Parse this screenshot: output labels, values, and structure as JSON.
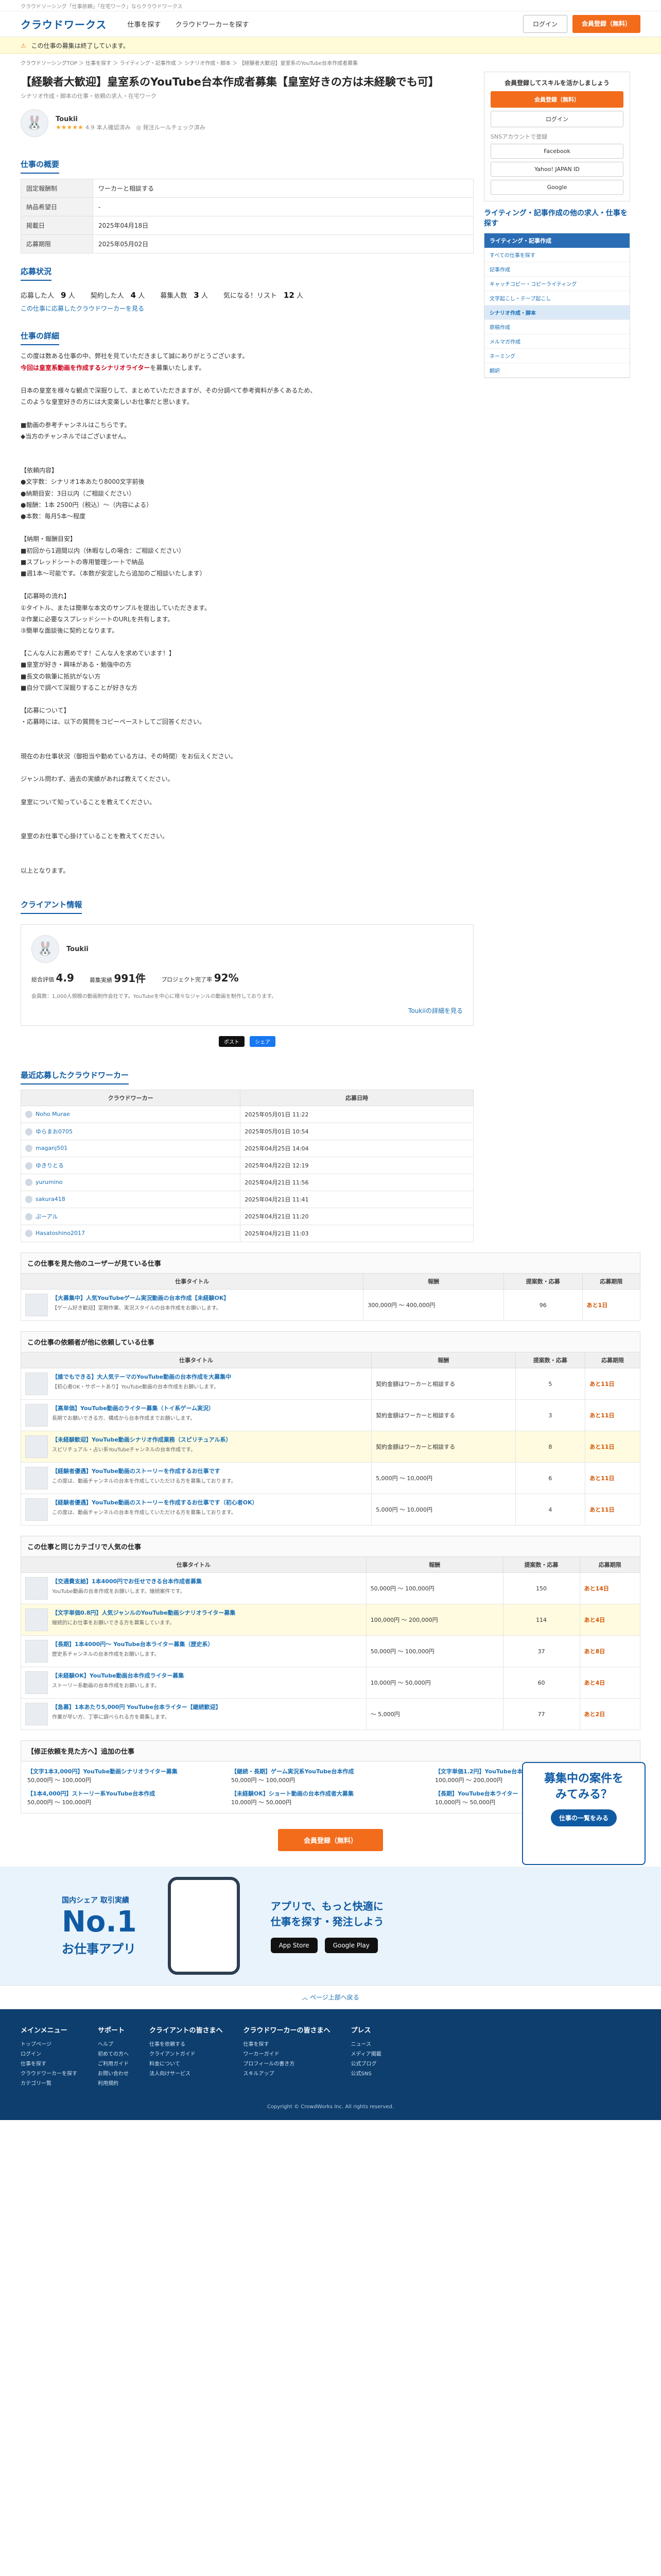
{
  "topstrip": "クラウドソーシング「仕事依頼」「在宅ワーク」ならクラウドワークス",
  "header": {
    "logo": "クラウドワークス",
    "nav": [
      "仕事を探す",
      "クラウドワーカーを探す"
    ],
    "login": "ログイン",
    "signup": "会員登録（無料）"
  },
  "notice": "この仕事の募集は終了しています。",
  "breadcrumb": "クラウドソーシングTOP ＞ 仕事を探す ＞ ライティング・記事作成 ＞ シナリオ作成・脚本 ＞ 【経験者大歓迎】皇室系のYouTube台本作成者募集",
  "job": {
    "title": "【経験者大歓迎】皇室系のYouTube台本作成者募集【皇室好きの方は未経験でも可】",
    "tags": "シナリオ作成・脚本の仕事・依頼の求人・在宅ワーク",
    "client_name": "Toukii",
    "client_rating": "4.9",
    "client_meta": "本人確認済み　◎ 発注ルールチェック済み"
  },
  "overview": {
    "title": "仕事の概要",
    "rows": [
      {
        "k": "固定報酬制",
        "v": "ワーカーと相談する"
      },
      {
        "k": "納品希望日",
        "v": "-"
      },
      {
        "k": "掲載日",
        "v": "2025年04月18日"
      },
      {
        "k": "応募期限",
        "v": "2025年05月02日"
      }
    ]
  },
  "apply": {
    "title": "応募状況",
    "items": [
      {
        "label": "応募した人",
        "value": "9",
        "unit": "人"
      },
      {
        "label": "契約した人",
        "value": "4",
        "unit": "人"
      },
      {
        "label": "募集人数",
        "value": "3",
        "unit": "人"
      },
      {
        "label": "気になる！リスト",
        "value": "12",
        "unit": "人"
      }
    ],
    "link": "この仕事に応募したクラウドワーカーを見る"
  },
  "detail": {
    "title": "仕事の詳細",
    "p1": "この度は数ある仕事の中、弊社を見ていただきまして誠にありがとうございます。",
    "p1_red": "今回は皇室系動画を作成するシナリオライター",
    "p1_rest": "を募集いたします。",
    "body": "日本の皇室を様々な観点で深掘りして、まとめていただきますが、その分調べて参考資料が多くあるため、\nこのような皇室好きの方には大変楽しいお仕事だと思います。\n\n■動画の参考チャンネルはこちらです。\n◆当方のチャンネルではございません。\n\n\n【依頼内容】\n●文字数：シナリオ1本あたり8000文字前後\n●納期目安：3日以内（ご相談ください）\n●報酬：1本 2500円（税込）〜（内容による）\n●本数：毎月5本〜程度\n\n【納期・報酬目安】\n■初回から1週間以内（休暇なしの場合：ご相談ください）\n■スプレッドシートの専用管理シートで納品\n■週1本〜可能です。（本数が安定したら追加のご相談いたします）\n\n【応募時の流れ】\n①タイトル、または簡単な本文のサンプルを提出していただきます。\n②作業に必要なスプレッドシートのURLを共有します。\n③簡単な面談後に契約となります。\n\n【こんな人にお薦めです！こんな人を求めています！】\n■皇室が好き・興味がある・勉強中の方\n■長文の執筆に抵抗がない方\n■自分で調べて深掘りすることが好きな方\n\n【応募について】\n・応募時には、以下の質問をコピーペーストしてご回答ください。\n\n\n現在のお仕事状況（御担当や勤めている方は、その時間）をお伝えください。\n\nジャンル問わず、過去の実績があれば教えてください。\n\n皇室について知っていることを教えてください。\n\n\n皇室のお仕事で心掛けていることを教えてください。\n\n\n以上となります。"
  },
  "client_info": {
    "title": "クライアント情報",
    "name": "Toukii",
    "stats": [
      {
        "label": "総合評価",
        "value": "4.9"
      },
      {
        "label": "募集実績",
        "value": "991件"
      },
      {
        "label": "プロジェクト完了率",
        "value": "92%"
      }
    ],
    "desc": "会員数：1,000人規模の動画制作会社です。YouTubeを中心に様々なジャンルの動画を制作しております。",
    "link": "Toukiiの詳細を見る"
  },
  "share": [
    "ポスト",
    "シェア"
  ],
  "recent_workers": {
    "title": "最近応募したクラウドワーカー",
    "headers": [
      "クラウドワーカー",
      "応募日時"
    ],
    "rows": [
      {
        "name": "Noho Murae",
        "date": "2025年05月01日 11:22"
      },
      {
        "name": "ゆらまお0705",
        "date": "2025年05月01日 10:54"
      },
      {
        "name": "maganj501",
        "date": "2025年04月25日 14:04"
      },
      {
        "name": "ゆきりとる",
        "date": "2025年04月22日 12:19"
      },
      {
        "name": "yurumino",
        "date": "2025年04月21日 11:56"
      },
      {
        "name": "sakura418",
        "date": "2025年04月21日 11:41"
      },
      {
        "name": "ぷーアル",
        "date": "2025年04月21日 11:20"
      },
      {
        "name": "Hasatoshino2017",
        "date": "2025年04月21日 11:03"
      }
    ]
  },
  "related1": {
    "title": "この仕事を見た他のユーザーが見ている仕事",
    "headers": [
      "仕事タイトル",
      "報酬",
      "提案数・応募",
      "応募期限"
    ],
    "rows": [
      {
        "t": "【大募集中】人気YouTubeゲーム実況動画の台本作成【未経験OK】",
        "d": "【ゲーム好き歓迎】定期作業、実況スタイルの台本作成をお願いします。",
        "p": "300,000円 〜 400,000円",
        "n": "96",
        "dl": "あと1日"
      }
    ]
  },
  "related2": {
    "title": "この仕事の依頼者が他に依頼している仕事",
    "headers": [
      "仕事タイトル",
      "報酬",
      "提案数・応募",
      "応募期限"
    ],
    "rows": [
      {
        "t": "【誰でもできる】大人気テーマのYouTube動画の台本作成を大募集中",
        "d": "【初心者OK・サポートあり】YouTube動画の台本作成をお願いします。",
        "p": "契約金額はワーカーと相談する",
        "n": "5",
        "dl": "あと11日"
      },
      {
        "t": "【高単価】YouTube動画のライター募集（トイ系ゲーム実況）",
        "d": "長期でお願いできる方、構成から台本作成までお願いします。",
        "p": "契約金額はワーカーと相談する",
        "n": "3",
        "dl": "あと11日"
      },
      {
        "t": "【未経験歓迎】YouTube動画シナリオ作成業務（スピリチュアル系）",
        "d": "スピリチュアル・占い系YouTubeチャンネルの台本作成です。",
        "p": "契約金額はワーカーと相談する",
        "n": "8",
        "dl": "あと11日"
      },
      {
        "t": "【経験者優遇】YouTube動画のストーリーを作成するお仕事です",
        "d": "この度は、動画チャンネルの台本を作成していただける方を募集しております。",
        "p": "5,000円 〜 10,000円",
        "n": "6",
        "dl": "あと11日"
      },
      {
        "t": "【経験者優遇】YouTube動画のストーリーを作成するお仕事です（初心者OK）",
        "d": "この度は、動画チャンネルの台本を作成していただける方を募集しております。",
        "p": "5,000円 〜 10,000円",
        "n": "4",
        "dl": "あと11日"
      }
    ]
  },
  "related3": {
    "title": "この仕事と同じカテゴリで人気の仕事",
    "headers": [
      "仕事タイトル",
      "報酬",
      "提案数・応募",
      "応募期限"
    ],
    "rows": [
      {
        "t": "【交通費支給】1本4000円でお任せできる台本作成者募集",
        "d": "YouTube動画の台本作成をお願いします。継続案件です。",
        "p": "50,000円 〜 100,000円",
        "n": "150",
        "dl": "あと14日"
      },
      {
        "t": "【文字単価0.8円】人気ジャンルのYouTube動画シナリオライター募集",
        "d": "継続的にお仕事をお願いできる方を募集しています。",
        "p": "100,000円 〜 200,000円",
        "n": "114",
        "dl": "あと4日"
      },
      {
        "t": "【長期】1本4000円〜 YouTube台本ライター募集（歴史系）",
        "d": "歴史系チャンネルの台本作成をお願いします。",
        "p": "50,000円 〜 100,000円",
        "n": "37",
        "dl": "あと8日"
      },
      {
        "t": "【未経験OK】YouTube動画台本作成ライター募集",
        "d": "ストーリー系動画の台本作成をお願いします。",
        "p": "10,000円 〜 50,000円",
        "n": "60",
        "dl": "あと4日"
      },
      {
        "t": "【急募】1本あたり5,000円 YouTube台本ライター【継続歓迎】",
        "d": "作業が早い方、丁寧に調べられる方を募集します。",
        "p": "〜 5,000円",
        "n": "77",
        "dl": "あと2日"
      }
    ]
  },
  "related4": {
    "title": "【修正依頼を見た方へ】追加の仕事",
    "cards": [
      {
        "t": "【文字1本3,000円】YouTube動画シナリオライター募集",
        "p": "50,000円 〜 100,000円"
      },
      {
        "t": "【継続・長期】ゲーム実況系YouTube台本作成",
        "p": "50,000円 〜 100,000円"
      },
      {
        "t": "【文字単価1.2円】YouTube台本ライター募集",
        "p": "100,000円 〜 200,000円"
      },
      {
        "t": "【1本4,000円】ストーリー系YouTube台本作成",
        "p": "50,000円 〜 100,000円"
      },
      {
        "t": "【未経験OK】ショート動画の台本作成者大募集",
        "p": "10,000円 〜 50,000円"
      },
      {
        "t": "【長期】YouTube台本ライター（雑学系）",
        "p": "10,000円 〜 50,000円"
      }
    ]
  },
  "cta": "会員登録（無料）",
  "app": {
    "small": "国内シェア 取引実績",
    "big": "No.1",
    "sub": "お仕事アプリ",
    "right": "アプリで、もっと快適に\n仕事を探す・発注しよう",
    "stores": [
      "App Store",
      "Google Play"
    ]
  },
  "pagetop": "ページ上部へ戻る",
  "footer": {
    "cols": [
      {
        "h": "メインメニュー",
        "items": [
          "トップページ",
          "ログイン",
          "仕事を探す",
          "クラウドワーカーを探す",
          "カテゴリ一覧"
        ]
      },
      {
        "h": "サポート",
        "items": [
          "ヘルプ",
          "初めての方へ",
          "ご利用ガイド",
          "お問い合わせ",
          "利用規約"
        ]
      },
      {
        "h": "クライアントの皆さまへ",
        "items": [
          "仕事を依頼する",
          "クライアントガイド",
          "料金について",
          "法人向けサービス"
        ]
      },
      {
        "h": "クラウドワーカーの皆さまへ",
        "items": [
          "仕事を探す",
          "ワーカーガイド",
          "プロフィールの書き方",
          "スキルアップ"
        ]
      },
      {
        "h": "プレス",
        "items": [
          "ニュース",
          "メディア掲載",
          "公式ブログ",
          "公式SNS"
        ]
      }
    ],
    "copy": "Copyright © CrowdWorks Inc. All rights reserved."
  },
  "side": {
    "box_title": "会員登録してスキルを活かしましょう",
    "signup": "会員登録（無料）",
    "login": "ログイン",
    "social_title": "SNSアカウントで登録",
    "social": [
      "Facebook",
      "Yahoo! JAPAN ID",
      "Google"
    ],
    "cat_title": "ライティング・記事作成の他の求人・仕事を探す",
    "cat_head": "ライティング・記事作成",
    "cats": [
      "すべての仕事を探す",
      "記事作成",
      "キャッチコピー・コピーライティング",
      "文字起こし・テープ起こし",
      "シナリオ作成・脚本",
      "原稿作成",
      "メルマガ作成",
      "ネーミング",
      "翻訳"
    ]
  },
  "promo": {
    "t": "募集中の案件を\nみてみる？",
    "b": "仕事の一覧をみる"
  }
}
